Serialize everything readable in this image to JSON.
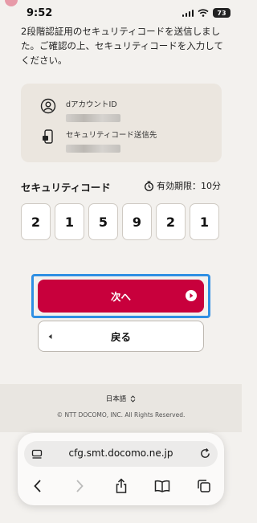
{
  "status_bar": {
    "time": "9:52",
    "battery": "73"
  },
  "intro_text": "2段階認証用のセキュリティコードを送信しました。ご確認の上、セキュリティコードを入力してください。",
  "info_card": {
    "account_label": "dアカウントID",
    "destination_label": "セキュリティコード送信先"
  },
  "security_code": {
    "title": "セキュリティコード",
    "expiry": "有効期限：10分",
    "digits": [
      "2",
      "1",
      "5",
      "9",
      "2",
      "1"
    ]
  },
  "buttons": {
    "next": "次へ",
    "back": "戻る"
  },
  "footer": {
    "language": "日本語",
    "copyright": "© NTT DOCOMO, INC. All Rights Reserved."
  },
  "browser": {
    "url": "cfg.smt.docomo.ne.jp"
  },
  "colors": {
    "accent": "#c8003c",
    "highlight": "#2f8fe3",
    "background": "#f3f1ee"
  },
  "icons": [
    "person-icon",
    "phone-icon",
    "timer-icon",
    "arrow-right-icon",
    "arrow-left-icon",
    "reader-icon",
    "reload-icon",
    "back-icon",
    "forward-icon",
    "share-icon",
    "bookmarks-icon",
    "tabs-icon"
  ]
}
